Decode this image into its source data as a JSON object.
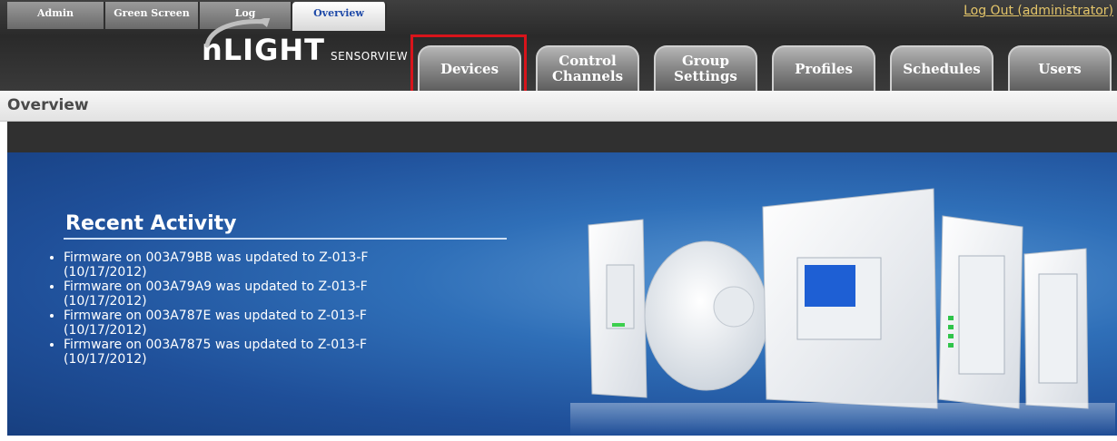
{
  "top_tabs": [
    {
      "label": "Admin",
      "active": false
    },
    {
      "label": "Green Screen",
      "active": false
    },
    {
      "label": "Log",
      "active": false
    },
    {
      "label": "Overview",
      "active": true
    }
  ],
  "logout_label": "Log Out (administrator)",
  "logo": {
    "main": "nLIGHT",
    "sub": "SENSORVIEW"
  },
  "nav_tabs": [
    {
      "label": "Devices",
      "highlighted": true
    },
    {
      "label": "Control Channels"
    },
    {
      "label": "Group Settings"
    },
    {
      "label": "Profiles"
    },
    {
      "label": "Schedules"
    },
    {
      "label": "Users"
    }
  ],
  "breadcrumb": "Overview",
  "recent_activity": {
    "title": "Recent Activity",
    "items": [
      {
        "line1": "Firmware on 003A79BB was updated to Z-013-F",
        "line2": "(10/17/2012)"
      },
      {
        "line1": "Firmware on 003A79A9 was updated to Z-013-F",
        "line2": "(10/17/2012)"
      },
      {
        "line1": "Firmware on 003A787E was updated to Z-013-F",
        "line2": "(10/17/2012)"
      },
      {
        "line1": "Firmware on 003A7875 was updated to Z-013-F",
        "line2": "(10/17/2012)"
      }
    ]
  },
  "colors": {
    "highlight_box": "#d8141b",
    "banner_blue": "#2f6fb8",
    "logout_link": "#e4c56a",
    "active_tab_text": "#1f4aa8"
  },
  "icons": {
    "product_image": "nlight-device-lineup-image"
  }
}
